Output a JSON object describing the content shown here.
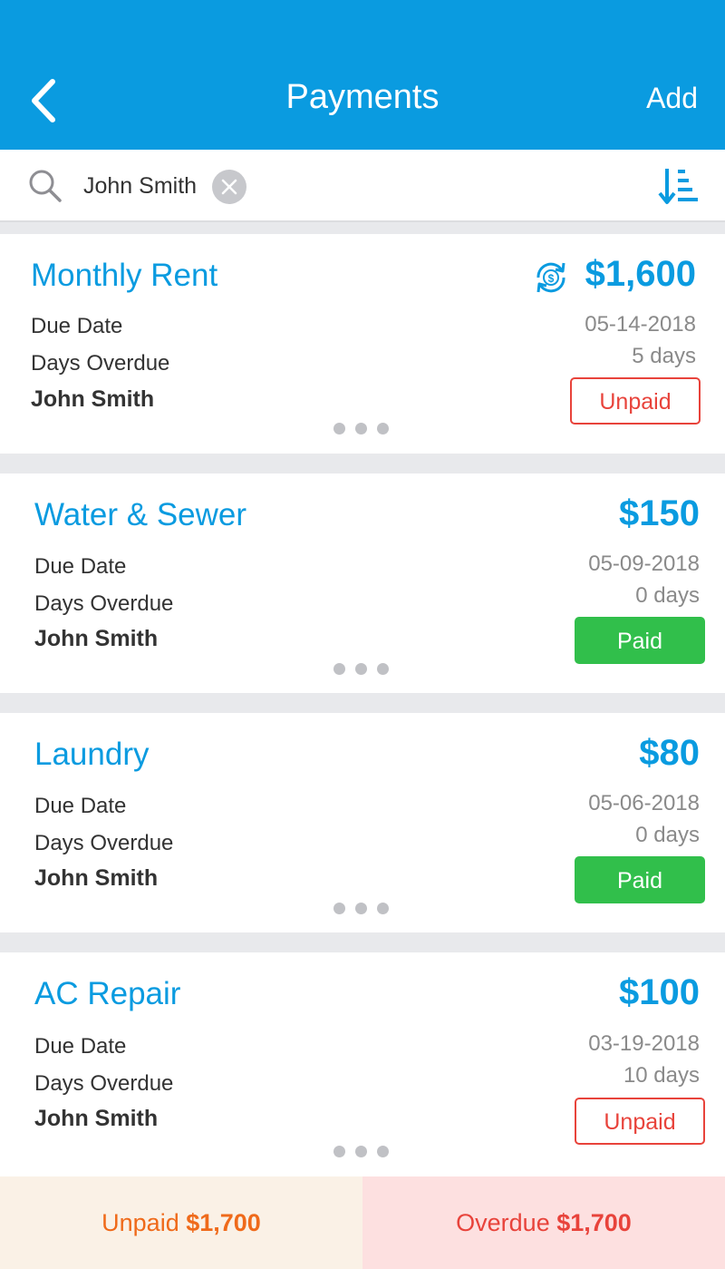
{
  "header": {
    "title": "Payments",
    "add_label": "Add",
    "back_icon": "chevron-left-icon"
  },
  "search": {
    "value": "John Smith",
    "icons": [
      "search-icon",
      "clear-icon",
      "sort-icon"
    ]
  },
  "payments": [
    {
      "name": "Monthly Rent",
      "amount": "$1,600",
      "recurring": true,
      "due_label": "Due Date",
      "due_date": "05-14-2018",
      "overdue_label": "Days Overdue",
      "days_overdue": "5 days",
      "owner": "John Smith",
      "status": "Unpaid"
    },
    {
      "name": "Water & Sewer",
      "amount": "$150",
      "recurring": false,
      "due_label": "Due Date",
      "due_date": "05-09-2018",
      "overdue_label": "Days Overdue",
      "days_overdue": "0 days",
      "owner": "John Smith",
      "status": "Paid"
    },
    {
      "name": "Laundry",
      "amount": "$80",
      "recurring": false,
      "due_label": "Due Date",
      "due_date": "05-06-2018",
      "overdue_label": "Days Overdue",
      "days_overdue": "0 days",
      "owner": "John Smith",
      "status": "Paid"
    },
    {
      "name": "AC Repair",
      "amount": "$100",
      "recurring": false,
      "due_label": "Due Date",
      "due_date": "03-19-2018",
      "overdue_label": "Days Overdue",
      "days_overdue": "10 days",
      "owner": "John Smith",
      "status": "Unpaid"
    }
  ],
  "footer": {
    "unpaid_label": "Unpaid",
    "unpaid_total": "$1,700",
    "overdue_label": "Overdue",
    "overdue_total": "$1,700"
  },
  "colors": {
    "accent": "#0a9be0",
    "paid": "#31bf4b",
    "unpaid": "#e8433b",
    "footer_unpaid": "#ef6a1a"
  }
}
